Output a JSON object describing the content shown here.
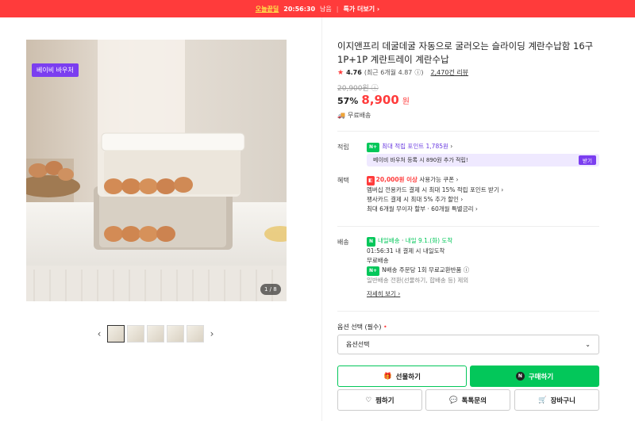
{
  "topbar": {
    "brand": "오늘끝딜",
    "time": "20:56:30",
    "remaining": "남음",
    "more": "더보기",
    "more_prefix": "특가"
  },
  "gallery": {
    "badge": "베이비 바우처",
    "counter": "1 / 8",
    "thumbs": 5
  },
  "product": {
    "title": "이지앤프리 데굴데굴 자동으로 굴러오는 슬라이딩 계란수납함 16구 1P+1P 계란트레이 계란수납",
    "rating_score": "4.76",
    "rating_recent": "(최근 6개월 4.87",
    "reviews": "2,470건 리뷰",
    "original_price": "20,900원",
    "discount": "57%",
    "price": "8,900",
    "price_unit": "원",
    "shipping_free": "무료배송"
  },
  "points": {
    "label": "적립",
    "max_point": "최대 적립 포인트 1,785원",
    "voucher_text": "베이비 바우처 등록 시 890원 추가 적립!",
    "voucher_button": "받기"
  },
  "benefits": {
    "label": "혜택",
    "coupon_amount": "20,000원 이상",
    "coupon_text": "사용가능 쿠폰",
    "line2": "멤버십 전용카드 결제 시 최대 15% 적립 포인트 받기",
    "line3": "팽사카드 결제 시 최대 5% 추가 할인",
    "line4": "최대 6개월 무이자 할부 · 60개월 특별금리"
  },
  "delivery": {
    "label": "배송",
    "type": "내일배송",
    "arrival": "내일 9.1.(화) 도착",
    "deadline": "01:56:31",
    "deadline_text": "내 결제 시 내일도착",
    "free": "무료배송",
    "return_text": "N배송 주문당 1회 무료교환반품",
    "note": "일반배송 전환(선물하기, 합배송 등) 제외",
    "more": "자세히 보기"
  },
  "options": {
    "label": "옵션 선택 (필수)",
    "selected": "옵션선택"
  },
  "buttons": {
    "gift": "선물하기",
    "buy": "구매하기",
    "wish": "찜하기",
    "talk": "톡톡문의",
    "cart": "장바구니"
  }
}
